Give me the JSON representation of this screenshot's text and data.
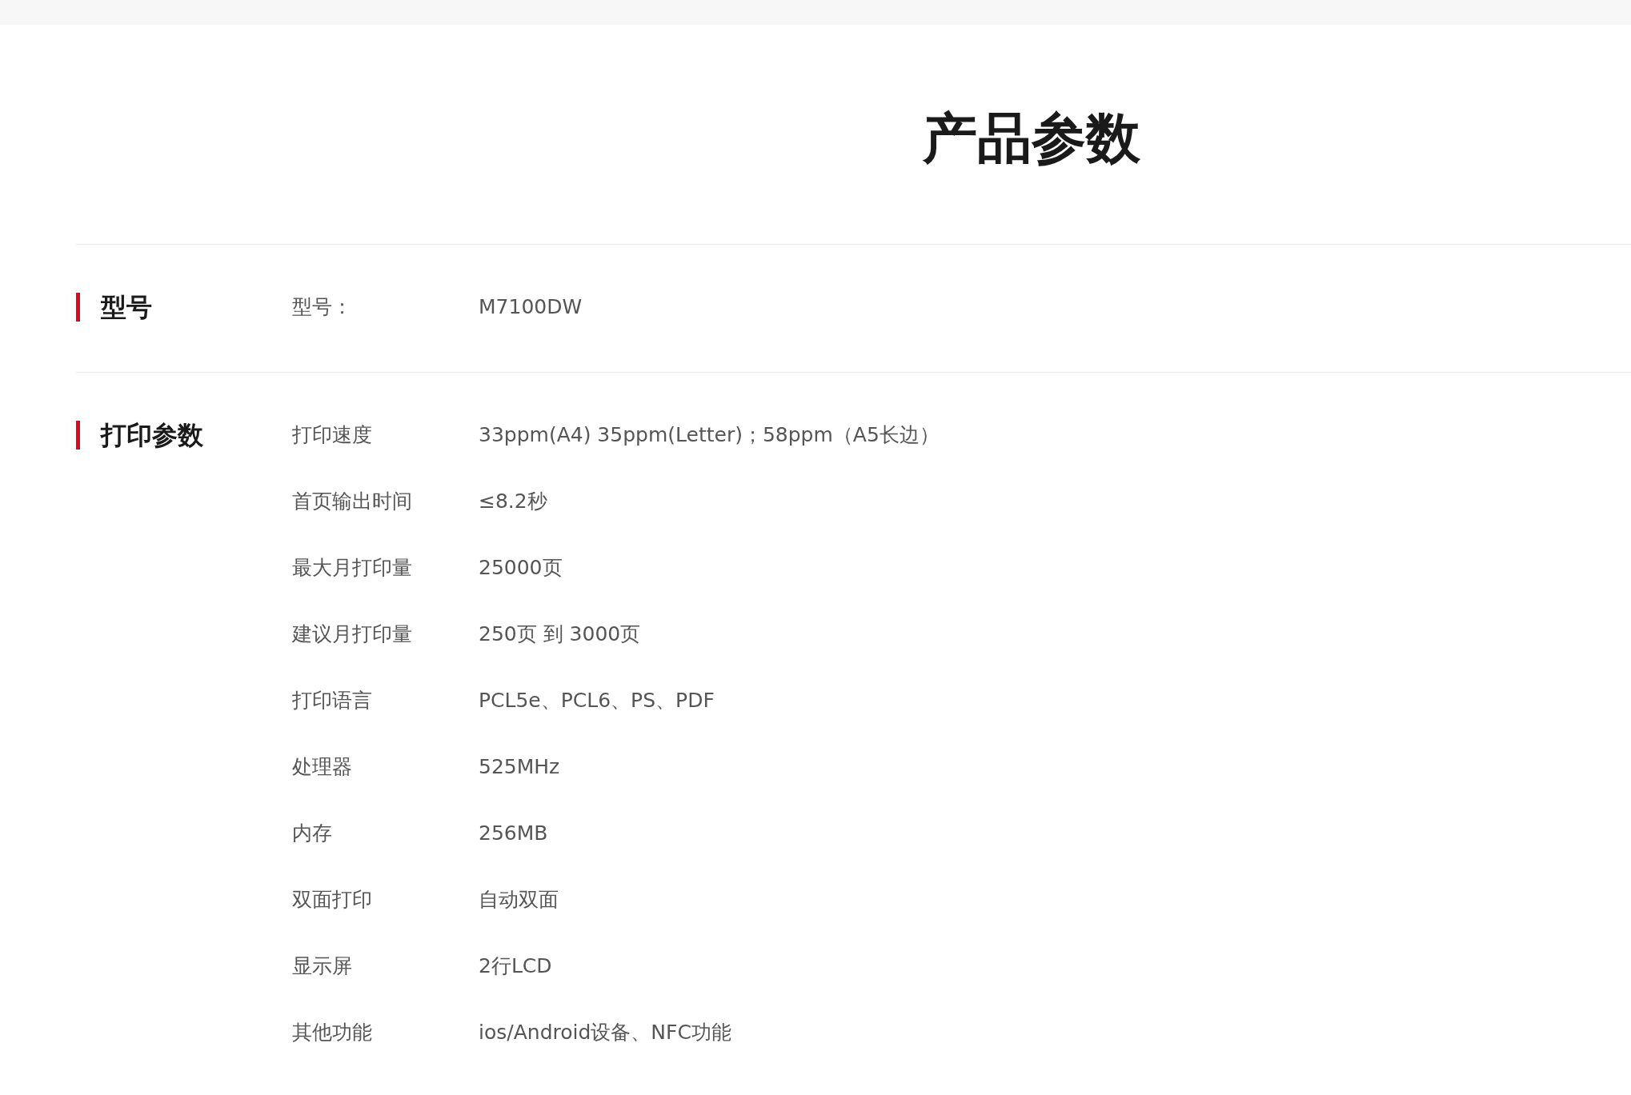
{
  "title": "产品参数",
  "sections": [
    {
      "heading": "型号",
      "params": [
        {
          "label": "型号：",
          "value": "M7100DW"
        }
      ]
    },
    {
      "heading": "打印参数",
      "params": [
        {
          "label": "打印速度",
          "value": "33ppm(A4) 35ppm(Letter)；58ppm（A5长边）"
        },
        {
          "label": "首页输出时间",
          "value": "≤8.2秒"
        },
        {
          "label": "最大月打印量",
          "value": "25000页"
        },
        {
          "label": "建议月打印量",
          "value": "250页 到 3000页"
        },
        {
          "label": "打印语言",
          "value": "PCL5e、PCL6、PS、PDF"
        },
        {
          "label": "处理器",
          "value": "525MHz"
        },
        {
          "label": "内存",
          "value": "256MB"
        },
        {
          "label": "双面打印",
          "value": "自动双面"
        },
        {
          "label": "显示屏",
          "value": "2行LCD"
        },
        {
          "label": "其他功能",
          "value": "ios/Android设备、NFC功能"
        }
      ]
    }
  ]
}
